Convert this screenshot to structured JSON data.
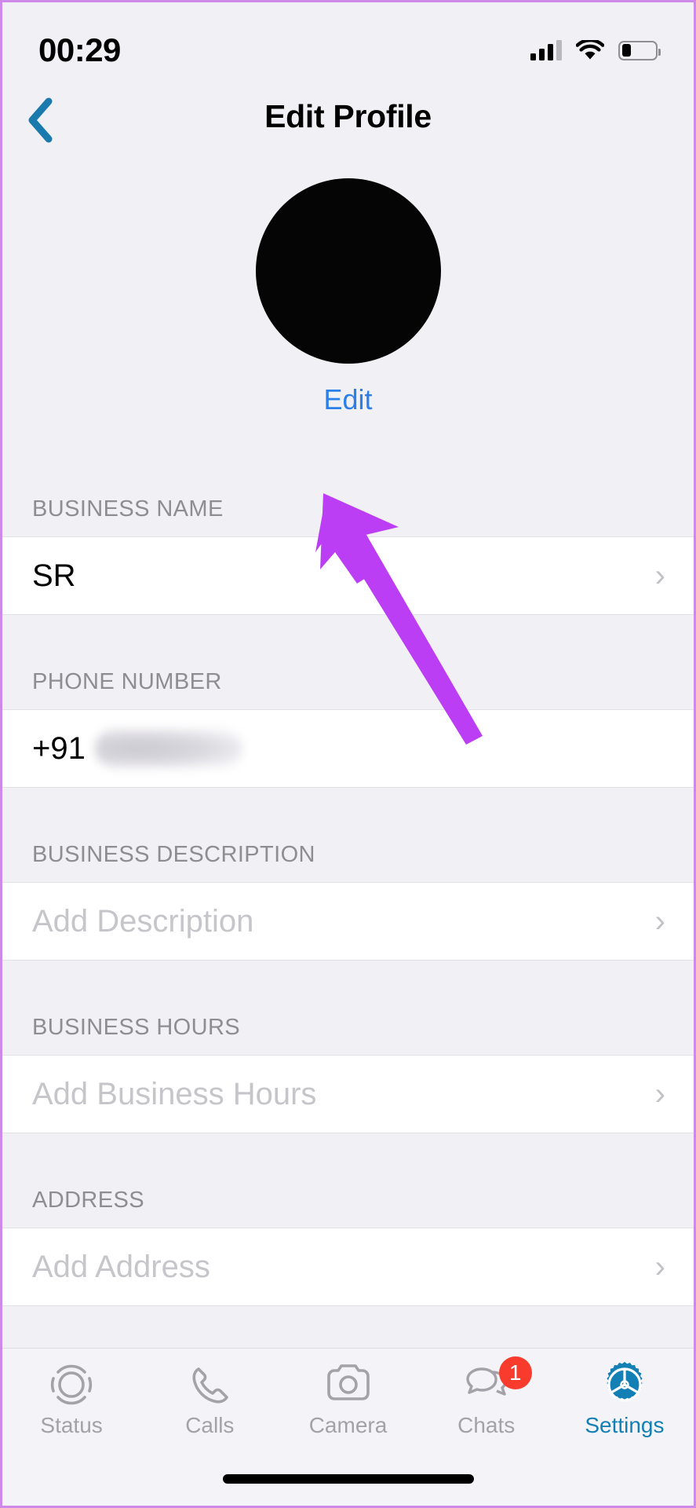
{
  "theme": {
    "accent_blue": "#2a7fe8",
    "tab_active_blue": "#1380b5",
    "chevron_blue": "#1a7aad",
    "annotation_purple": "#bb3ef5",
    "badge_red": "#f83b2c",
    "section_bg": "#f1f0f5",
    "row_bg": "#ffffff",
    "label_gray": "#8d8d92",
    "placeholder_gray": "#c6c5ca"
  },
  "status_bar": {
    "time": "00:29",
    "signal_icon": "cellular-bars-icon",
    "signal_bars_filled": 3,
    "signal_bars_total": 4,
    "wifi_icon": "wifi-icon",
    "battery_icon": "battery-icon",
    "battery_level_percent": 26
  },
  "nav": {
    "back_icon": "chevron-left-icon",
    "title": "Edit Profile"
  },
  "profile": {
    "avatar_name": "profile-avatar",
    "edit_label": "Edit"
  },
  "annotation": {
    "type": "arrow",
    "points_to": "Edit",
    "color": "#bb3ef5"
  },
  "sections": [
    {
      "label": "BUSINESS NAME",
      "name": "business-name",
      "value": "SR",
      "is_placeholder": false,
      "redacted": false,
      "chevron": "chevron-right-icon"
    },
    {
      "label": "PHONE NUMBER",
      "name": "phone-number",
      "value": "+91",
      "is_placeholder": false,
      "redacted": true,
      "chevron": ""
    },
    {
      "label": "BUSINESS DESCRIPTION",
      "name": "business-description",
      "value": "Add Description",
      "is_placeholder": true,
      "redacted": false,
      "chevron": "chevron-right-icon"
    },
    {
      "label": "BUSINESS HOURS",
      "name": "business-hours",
      "value": "Add Business Hours",
      "is_placeholder": true,
      "redacted": false,
      "chevron": "chevron-right-icon"
    },
    {
      "label": "ADDRESS",
      "name": "address",
      "value": "Add Address",
      "is_placeholder": true,
      "redacted": false,
      "chevron": "chevron-right-icon"
    }
  ],
  "tab_bar": {
    "items": [
      {
        "label": "Status",
        "icon": "status-rings-icon",
        "active": false,
        "badge": ""
      },
      {
        "label": "Calls",
        "icon": "phone-handset-icon",
        "active": false,
        "badge": ""
      },
      {
        "label": "Camera",
        "icon": "camera-icon",
        "active": false,
        "badge": ""
      },
      {
        "label": "Chats",
        "icon": "chat-bubbles-icon",
        "active": false,
        "badge": "1"
      },
      {
        "label": "Settings",
        "icon": "gear-icon",
        "active": true,
        "badge": ""
      }
    ]
  }
}
